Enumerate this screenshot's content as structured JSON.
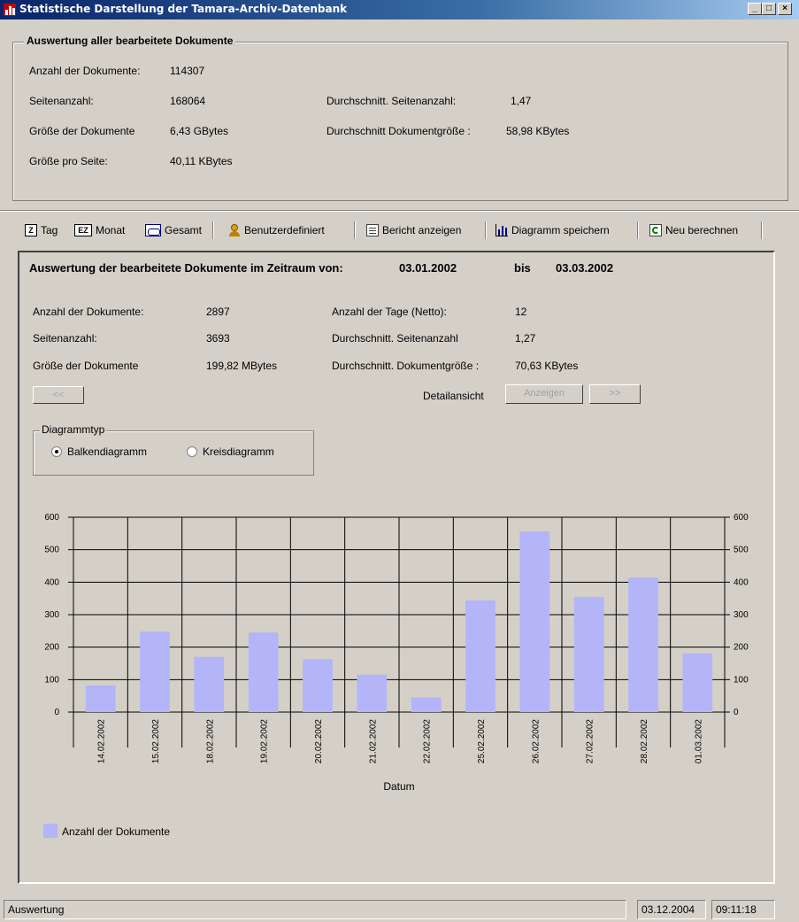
{
  "window": {
    "title": "Statistische Darstellung der Tamara-Archiv-Datenbank"
  },
  "overall": {
    "title": "Auswertung aller bearbeitete Dokumente",
    "doc_count_label": "Anzahl der Dokumente:",
    "doc_count": "114307",
    "pages_label": "Seitenanzahl:",
    "pages": "168064",
    "size_label": "Größe der Dokumente",
    "size": "6,43 GBytes",
    "size_per_page_label": "Größe pro Seite:",
    "size_per_page": "40,11 KBytes",
    "avg_pages_label": "Durchschnitt. Seitenanzahl:",
    "avg_pages": "1,47",
    "avg_size_label": "Durchschnitt Dokumentgröße :",
    "avg_size": "58,98 KBytes"
  },
  "toolbar": {
    "tag": "Tag",
    "monat": "Monat",
    "gesamt": "Gesamt",
    "benutzerdefiniert": "Benutzerdefiniert",
    "bericht": "Bericht anzeigen",
    "diagramm_speichern": "Diagramm speichern",
    "neu_berechnen": "Neu berechnen"
  },
  "period": {
    "heading": "Auswertung der bearbeitete Dokumente im Zeitraum von:",
    "from": "03.01.2002",
    "bis_label": "bis",
    "to": "03.03.2002",
    "doc_count_label": "Anzahl der Dokumente:",
    "doc_count": "2897",
    "pages_label": "Seitenanzahl:",
    "pages": "3693",
    "size_label": "Größe der Dokumente",
    "size": "199,82 MBytes",
    "days_label": "Anzahl der Tage (Netto):",
    "days": "12",
    "avg_pages_label": "Durchschnitt. Seitenanzahl",
    "avg_pages": "1,27",
    "avg_size_label": "Durchschnitt. Dokumentgröße :",
    "avg_size": "70,63 KBytes",
    "prev_label": "<<",
    "detail_label": "Detailansicht",
    "show_label": "Anzeigen",
    "next_label": ">>"
  },
  "diagram_type": {
    "legend": "Diagrammtyp",
    "bar": "Balkendiagramm",
    "pie": "Kreisdiagramm",
    "selected": "bar"
  },
  "chart_data": {
    "type": "bar",
    "categories": [
      "14.02.2002",
      "15.02.2002",
      "18.02.2002",
      "19.02.2002",
      "20.02.2002",
      "21.02.2002",
      "22.02.2002",
      "25.02.2002",
      "26.02.2002",
      "27.02.2002",
      "28.02.2002",
      "01.03.2002"
    ],
    "series": [
      {
        "name": "Anzahl der Dokumente",
        "values": [
          82,
          248,
          170,
          245,
          163,
          115,
          45,
          344,
          556,
          354,
          414,
          181
        ],
        "color": "#b4b4f8"
      }
    ],
    "xlabel": "Datum",
    "ylabel": "",
    "ylim": [
      0,
      600
    ],
    "yticks": [
      0,
      100,
      200,
      300,
      400,
      500,
      600
    ],
    "grid": true,
    "legend_position": "bottom-left"
  },
  "statusbar": {
    "text": "Auswertung",
    "date": "03.12.2004",
    "time": "09:11:18"
  }
}
